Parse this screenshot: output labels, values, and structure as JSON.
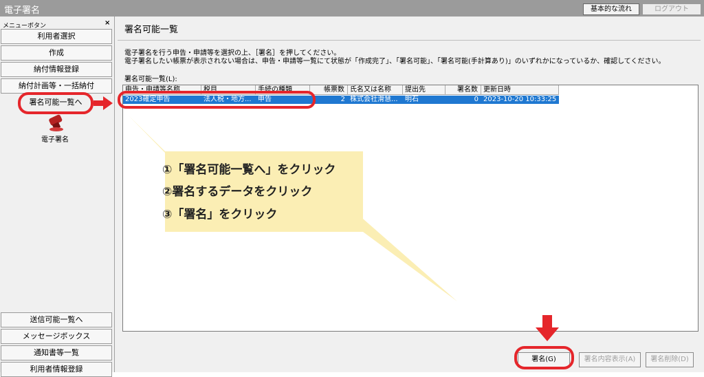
{
  "window": {
    "title": "電子署名",
    "flow_button": "基本的な流れ",
    "logout_button": "ログアウト"
  },
  "sidebar": {
    "header": "メニューボタン",
    "close": "×",
    "items": [
      {
        "label": "利用者選択"
      },
      {
        "label": "作成"
      },
      {
        "label": "納付情報登録"
      },
      {
        "label": "納付計画等・一括納付"
      },
      {
        "label": "署名可能一覧へ"
      }
    ],
    "icon_label": "電子署名",
    "bottom_items": [
      {
        "label": "送信可能一覧へ"
      },
      {
        "label": "メッセージボックス"
      },
      {
        "label": "通知書等一覧"
      },
      {
        "label": "利用者情報登録"
      }
    ]
  },
  "main": {
    "title": "署名可能一覧",
    "description_1": "電子署名を行う申告・申請等を選択の上、［署名］を押してください。",
    "description_2": "電子署名したい帳票が表示されない場合は、申告・申請等一覧にて状態が「作成完了」、「署名可能」、「署名可能(手計算あり)」のいずれかになっているか、確認してください。",
    "list_label": "署名可能一覧(L):",
    "columns": [
      "申告・申請等名称",
      "税目",
      "手続の種類",
      "帳票数",
      "氏名又は名称",
      "提出先",
      "署名数",
      "更新日時"
    ],
    "rows": [
      {
        "name": "2023確定申告",
        "tax": "法人税・地方...",
        "procedure": "申告",
        "forms": "2",
        "company": "株式会社滑慧...",
        "office": "明石",
        "signatures": "0",
        "updated": "2023-10-20 10:33:25"
      }
    ],
    "buttons": {
      "sign": "署名(G)",
      "show": "署名内容表示(A)",
      "delete": "署名削除(D)"
    }
  },
  "callout": {
    "step1": "①「署名可能一覧へ」をクリック",
    "step2": "②署名するデータをクリック",
    "step3": "③「署名」をクリック"
  },
  "colors": {
    "annotation_red": "#e5262b",
    "selection_blue": "#1f78d1",
    "callout_yellow": "#fbeeb4"
  }
}
